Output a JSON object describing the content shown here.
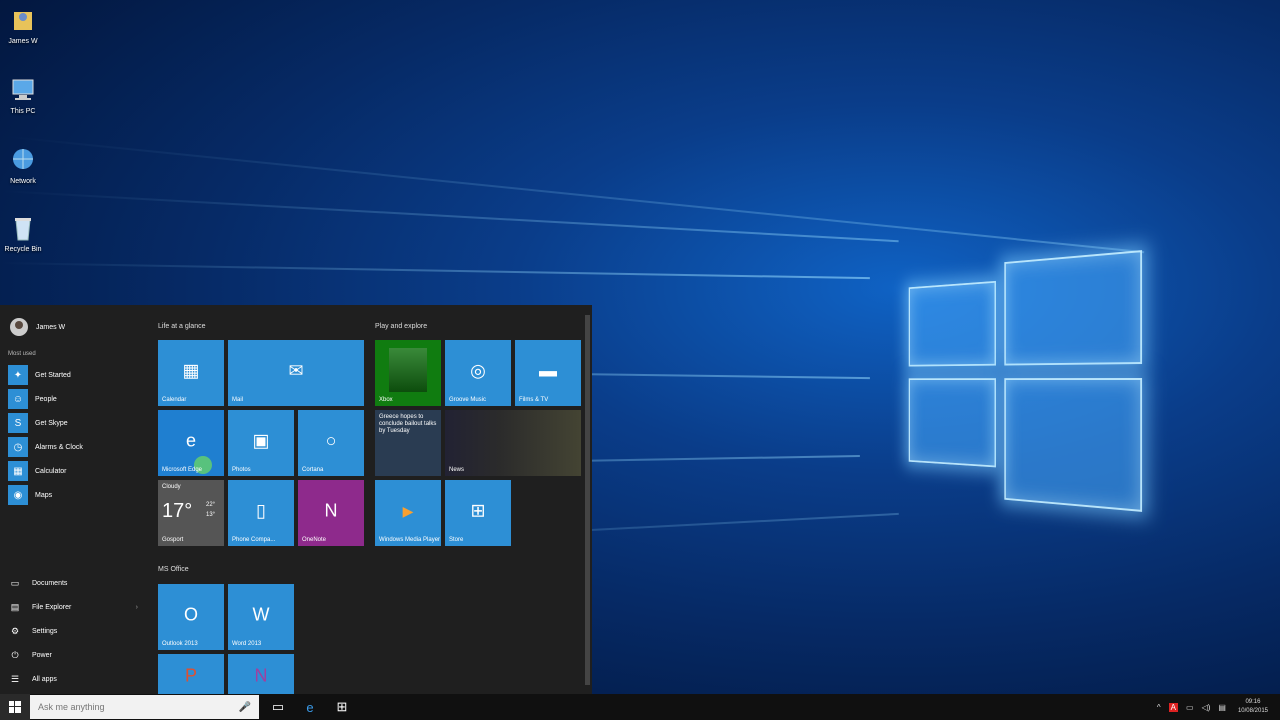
{
  "desktop": {
    "icons": [
      {
        "label": "James W",
        "icon": "user-folder-icon"
      },
      {
        "label": "This PC",
        "icon": "computer-icon"
      },
      {
        "label": "Network",
        "icon": "network-icon"
      },
      {
        "label": "Recycle Bin",
        "icon": "recycle-bin-icon"
      }
    ]
  },
  "start": {
    "user_name": "James W",
    "most_used_label": "Most used",
    "most_used": [
      {
        "label": "Get Started",
        "icon": "lightbulb-icon"
      },
      {
        "label": "People",
        "icon": "people-icon"
      },
      {
        "label": "Get Skype",
        "icon": "skype-icon"
      },
      {
        "label": "Alarms & Clock",
        "icon": "clock-icon"
      },
      {
        "label": "Calculator",
        "icon": "calculator-icon"
      },
      {
        "label": "Maps",
        "icon": "maps-icon"
      }
    ],
    "system": [
      {
        "label": "Documents",
        "icon": "folder-icon"
      },
      {
        "label": "File Explorer",
        "icon": "file-explorer-icon"
      },
      {
        "label": "Settings",
        "icon": "gear-icon"
      },
      {
        "label": "Power",
        "icon": "power-icon"
      },
      {
        "label": "All apps",
        "icon": "list-icon"
      }
    ],
    "groups": {
      "life": "Life at a glance",
      "play": "Play and explore",
      "office": "MS Office"
    },
    "tiles": {
      "calendar": "Calendar",
      "mail": "Mail",
      "edge": "Microsoft Edge",
      "photos": "Photos",
      "cortana": "Cortana",
      "weather_condition": "Cloudy",
      "weather_temp": "17°",
      "weather_high": "22°",
      "weather_low": "13°",
      "weather_city": "Gosport",
      "phone": "Phone Compa...",
      "onenote": "OneNote",
      "xbox": "Xbox",
      "groove": "Groove Music",
      "films": "Films & TV",
      "news_headline": "Greece hopes to conclude bailout talks by Tuesday",
      "news": "News",
      "wmp": "Windows Media Player",
      "store": "Store",
      "outlook": "Outlook 2013",
      "word": "Word 2013"
    }
  },
  "taskbar": {
    "search_placeholder": "Ask me anything",
    "time": "09:16",
    "date": "10/08/2015"
  }
}
